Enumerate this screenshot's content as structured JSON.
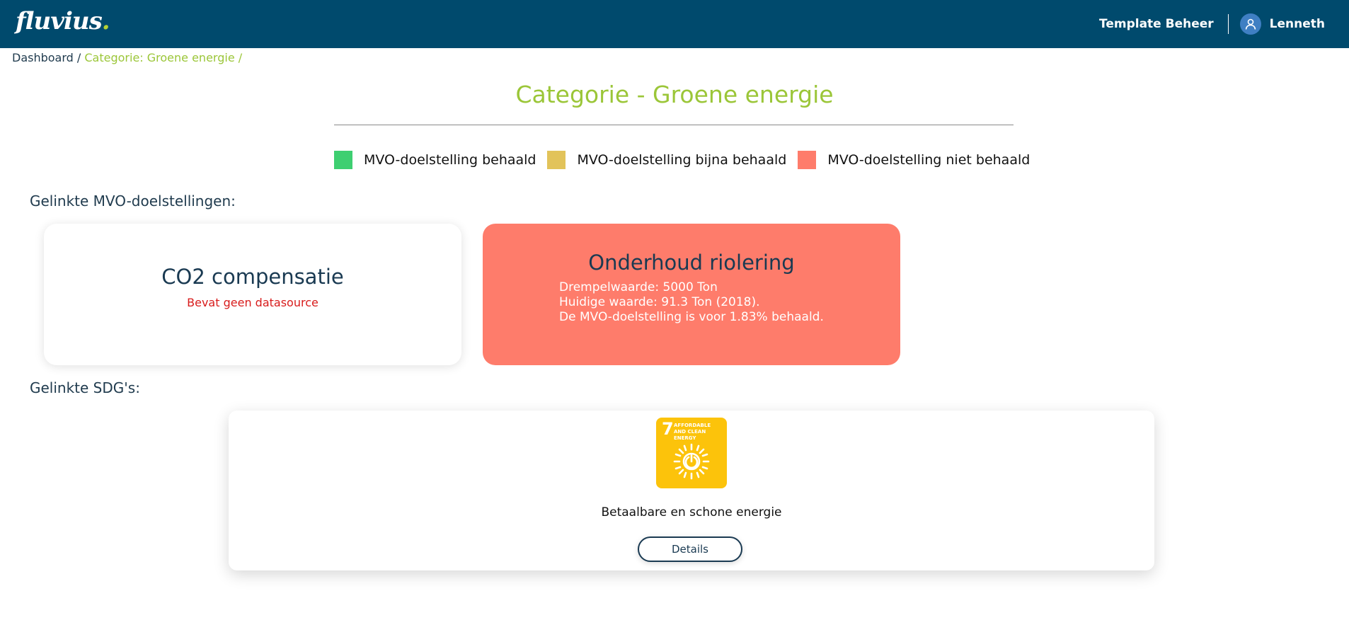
{
  "header": {
    "logo_text": "fluvius",
    "logo_dot": ".",
    "template_link": "Template Beheer",
    "user_name": "Lenneth",
    "colors": {
      "bar": "#004a6d",
      "logo_accent": "#b5d334"
    }
  },
  "breadcrumb": {
    "items": [
      "Dashboard /",
      "Categorie: Groene energie /"
    ]
  },
  "page": {
    "title": "Categorie - Groene energie",
    "title_color": "#9bc638"
  },
  "legend": [
    {
      "label": "MVO-doelstelling behaald",
      "color": "#3ecf71"
    },
    {
      "label": "MVO-doelstelling bijna behaald",
      "color": "#e2c35a"
    },
    {
      "label": "MVO-doelstelling niet behaald",
      "color": "#fe7c6b"
    }
  ],
  "sections": {
    "goals_label": "Gelinkte MVO-doelstellingen:",
    "sdgs_label": "Gelinkte SDG's:"
  },
  "goals": [
    {
      "title": "CO2 compensatie",
      "status": "none",
      "message": "Bevat geen datasource"
    },
    {
      "title": "Onderhoud riolering",
      "status": "niet behaald",
      "color": "#fe7c6b",
      "lines": [
        "Drempelwaarde: 5000 Ton",
        "Huidige waarde: 91.3 Ton (2018).",
        "De MVO-doelstelling is voor 1.83% behaald."
      ]
    }
  ],
  "sdgs": [
    {
      "number": "7",
      "tile_text": "AFFORDABLE AND CLEAN ENERGY",
      "icon": "sun-power-icon",
      "color": "#fcc30b",
      "name": "Betaalbare en schone energie",
      "button_label": "Details"
    }
  ]
}
